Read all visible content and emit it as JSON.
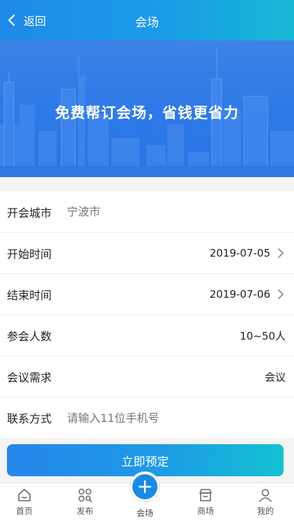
{
  "header": {
    "back_label": "返回",
    "title": "会场"
  },
  "banner": {
    "slogan": "免费帮订会场，省钱更省力"
  },
  "form": {
    "city": {
      "label": "开会城市",
      "placeholder": "宁波市"
    },
    "start": {
      "label": "开始时间",
      "value": "2019-07-05"
    },
    "end": {
      "label": "结束时间",
      "value": "2019-07-06"
    },
    "people": {
      "label": "参会人数",
      "value": "10~50人"
    },
    "need": {
      "label": "会议需求",
      "value": "会议"
    },
    "contact": {
      "label": "联系方式",
      "placeholder": "请输入11位手机号"
    }
  },
  "submit_label": "立即预定",
  "tabbar": {
    "items": [
      {
        "label": "首页",
        "icon": "home-icon"
      },
      {
        "label": "发布",
        "icon": "publish-icon"
      },
      {
        "label": "会场",
        "icon": "plus-icon"
      },
      {
        "label": "商场",
        "icon": "store-icon"
      },
      {
        "label": "我的",
        "icon": "user-icon"
      }
    ]
  },
  "colors": {
    "primary": "#1a8ae6",
    "accent": "#17b9d4"
  }
}
